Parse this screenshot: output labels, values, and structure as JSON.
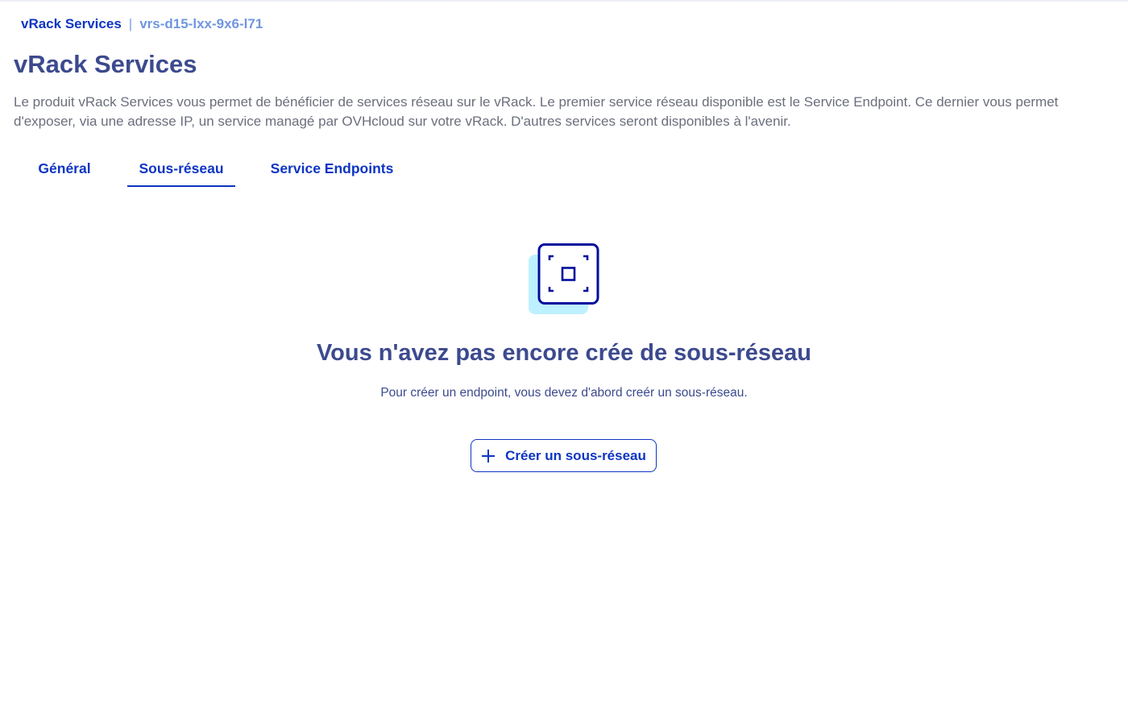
{
  "breadcrumb": {
    "root": "vRack Services",
    "separator": "|",
    "current": "vrs-d15-lxx-9x6-l71"
  },
  "page": {
    "title": "vRack Services",
    "description": "Le produit vRack Services vous permet de bénéficier de services réseau sur le vRack. Le premier service réseau disponible est le Service Endpoint. Ce dernier vous permet d'exposer, via une adresse IP, un service managé par OVHcloud sur votre vRack. D'autres services seront disponibles à l'avenir."
  },
  "tabs": [
    {
      "label": "Général",
      "active": false
    },
    {
      "label": "Sous-réseau",
      "active": true
    },
    {
      "label": "Service Endpoints",
      "active": false
    }
  ],
  "empty_state": {
    "icon": "focus-square-icon",
    "title": "Vous n'avez pas encore crée de sous-réseau",
    "subtitle": "Pour créer un endpoint, vous devez d'abord creér un sous-réseau.",
    "button_label": "Créer un sous-réseau",
    "button_icon": "plus-icon"
  },
  "colors": {
    "primary": "#0d35c3",
    "heading": "#3c4a8e",
    "text_muted": "#6b6f7c",
    "icon_accent": "#bef1ff",
    "icon_stroke": "#000e9c"
  }
}
